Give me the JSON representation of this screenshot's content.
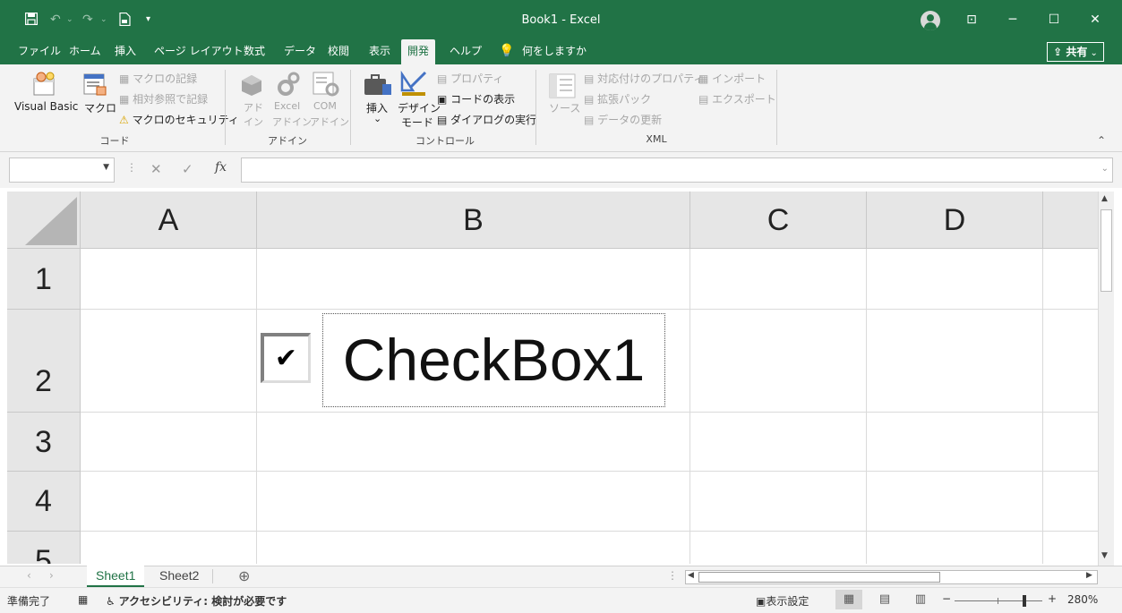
{
  "window": {
    "title": "Book1  -  Excel",
    "minimize_icon": "─",
    "restore_icon": "☐",
    "close_icon": "✕",
    "ribbon_display_icon": "⊡"
  },
  "quick_access": {
    "save_icon": "save-icon",
    "undo_icon": "↶",
    "redo_icon": "↷",
    "customize_icon": "▾"
  },
  "menu": {
    "tabs": [
      "ファイル",
      "ホーム",
      "挿入",
      "ページ レイアウト",
      "数式",
      "データ",
      "校閲",
      "表示",
      "開発",
      "ヘルプ"
    ],
    "active_tab": "開発",
    "tell_me": "何をしますか",
    "share": "共有"
  },
  "ribbon": {
    "code": {
      "visual_basic": "Visual Basic",
      "macro": "マクロ",
      "record_macro": "マクロの記録",
      "relative_ref": "相対参照で記録",
      "macro_security": "マクロのセキュリティ",
      "group_label": "コード"
    },
    "addins": {
      "addin_1": "アド",
      "addin_2": "イン",
      "excel_addin_1": "Excel",
      "excel_addin_2": "アドイン",
      "com_addin_1": "COM",
      "com_addin_2": "アドイン",
      "group_label": "アドイン"
    },
    "controls": {
      "insert": "挿入",
      "insert_arrow": "⌄",
      "design_mode_1": "デザイン",
      "design_mode_2": "モード",
      "properties": "プロパティ",
      "view_code": "コードの表示",
      "run_dialog": "ダイアログの実行",
      "group_label": "コントロール"
    },
    "xml": {
      "source": "ソース",
      "map_properties": "対応付けのプロパティ",
      "expansion_packs": "拡張パック",
      "refresh_data": "データの更新",
      "import": "インポート",
      "export": "エクスポート",
      "group_label": "XML"
    },
    "collapse_icon": "⌃"
  },
  "formula_bar": {
    "name_box": "",
    "formula": "",
    "cancel_icon": "✕",
    "enter_icon": "✓",
    "fx_label": "fx"
  },
  "grid": {
    "columns": [
      "A",
      "B",
      "C",
      "D"
    ],
    "rows": [
      "1",
      "2",
      "3",
      "4",
      "5"
    ]
  },
  "checkbox": {
    "label": "CheckBox1",
    "checked": true,
    "check_glyph": "✔"
  },
  "sheets": {
    "tabs": [
      "Sheet1",
      "Sheet2"
    ],
    "active": "Sheet1",
    "add_icon": "⊕",
    "prev_icon": "‹",
    "next_icon": "›"
  },
  "status": {
    "ready": "準備完了",
    "accessibility": "アクセシビリティ: 検討が必要です",
    "display_settings": "表示設定",
    "zoom_minus": "−",
    "zoom_plus": "+",
    "zoom": "280%",
    "zoom_level": 2.8
  },
  "colors": {
    "excel_green": "#217346",
    "ribbon_bg": "#f3f3f3",
    "header_bg": "#e6e6e6"
  }
}
